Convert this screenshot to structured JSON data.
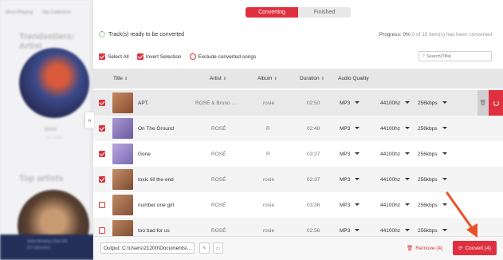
{
  "background": {
    "nav": [
      "Most Playing",
      "My Collection"
    ],
    "section1": "Trendsetters: Artist",
    "caption1": "Bilibili",
    "caption2": "14 Tracks",
    "section2": "Top artists",
    "player_line1": "Artist Monkey Club DA",
    "player_line2": "Di Cabochon"
  },
  "tabs": {
    "converting": "Converting",
    "finished": "Finished"
  },
  "status": {
    "ready_text": "Track(s) ready to be converted",
    "progress_label": "Progress:",
    "progress_value": "0%",
    "progress_detail": "0 of 15 item(s) has been converted"
  },
  "toolbar": {
    "select_all": "Select All",
    "invert": "Invert Selection",
    "exclude": "Exclude converted songs",
    "search_placeholder": "Search(Title)"
  },
  "columns": {
    "title": "Title",
    "artist": "Artist",
    "album": "Album",
    "duration": "Duration",
    "quality": "Audio Quality"
  },
  "rows": [
    {
      "title": "APT.",
      "artist": "ROSÉ & Bruno ...",
      "album": "rosie",
      "duration": "02:50",
      "format": "MP3",
      "rate": "44100hz",
      "bitrate": "256kbps",
      "checked": true,
      "thumb": "#b77a55"
    },
    {
      "title": "On The Ground",
      "artist": "ROSÉ",
      "album": "R",
      "duration": "02:48",
      "format": "MP3",
      "rate": "44100hz",
      "bitrate": "256kbps",
      "checked": true,
      "thumb": "#8a78b8"
    },
    {
      "title": "Gone",
      "artist": "ROSÉ",
      "album": "R",
      "duration": "03:27",
      "format": "MP3",
      "rate": "44100hz",
      "bitrate": "256kbps",
      "checked": true,
      "thumb": "#9a88c4"
    },
    {
      "title": "toxic till the end",
      "artist": "ROSÉ",
      "album": "rosie",
      "duration": "02:37",
      "format": "MP3",
      "rate": "44100hz",
      "bitrate": "256kbps",
      "checked": true,
      "thumb": "#b88060"
    },
    {
      "title": "number one girl",
      "artist": "ROSÉ",
      "album": "rosie",
      "duration": "03:36",
      "format": "MP3",
      "rate": "44100hz",
      "bitrate": "256kbps",
      "checked": false,
      "thumb": "#b07a5a"
    },
    {
      "title": "too bad for us",
      "artist": "ROSÉ",
      "album": "rosie",
      "duration": "02:56",
      "format": "MP3",
      "rate": "44100hz",
      "bitrate": "256kbps",
      "checked": false,
      "thumb": "#a87050"
    }
  ],
  "footer": {
    "output": "Output: C:\\Users\\21200\\Documents\\...",
    "remove": "Remove (4)",
    "convert": "Convert (4)"
  },
  "colors": {
    "accent": "#e0303f",
    "arrow": "#e8522a"
  },
  "icons": [
    "spinner-icon",
    "search-icon",
    "sort-icon",
    "dropdown-icon",
    "trash-icon",
    "convert-icon",
    "folder-icon",
    "collapse-icon"
  ]
}
